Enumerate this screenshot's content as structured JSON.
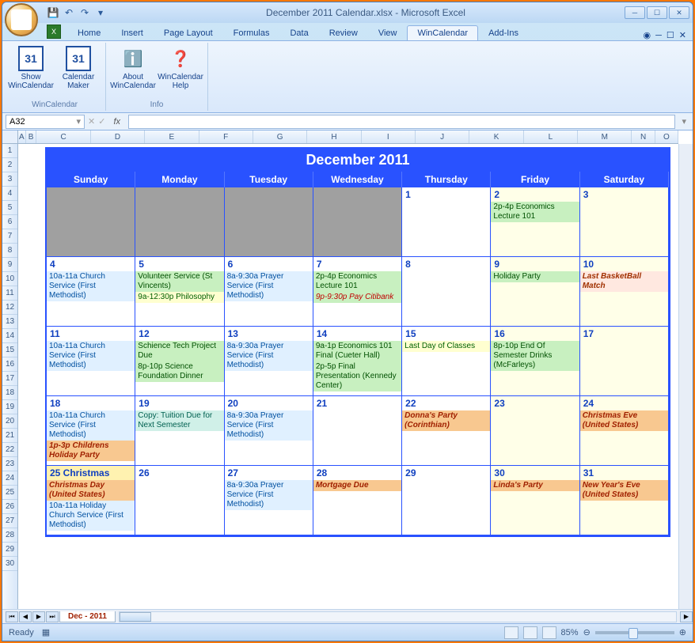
{
  "window": {
    "title": "December 2011 Calendar.xlsx - Microsoft Excel"
  },
  "tabs": {
    "items": [
      "Home",
      "Insert",
      "Page Layout",
      "Formulas",
      "Data",
      "Review",
      "View",
      "WinCalendar",
      "Add-Ins"
    ],
    "active": "WinCalendar"
  },
  "ribbon": {
    "groups": [
      {
        "label": "WinCalendar",
        "buttons": [
          {
            "icon": "📅",
            "iconText": "31",
            "label": "Show WinCalendar"
          },
          {
            "icon": "📅",
            "iconText": "31",
            "label": "Calendar Maker"
          }
        ]
      },
      {
        "label": "Info",
        "buttons": [
          {
            "icon": "ℹ️",
            "label": "About WinCalendar"
          },
          {
            "icon": "❓",
            "label": "WinCalendar Help"
          }
        ]
      }
    ]
  },
  "formulaBar": {
    "nameBox": "A32",
    "fx": "fx"
  },
  "columns": [
    "A",
    "B",
    "C",
    "D",
    "E",
    "F",
    "G",
    "H",
    "I",
    "J",
    "K",
    "L",
    "M",
    "N",
    "O"
  ],
  "rows": [
    "1",
    "2",
    "3",
    "4",
    "5",
    "6",
    "7",
    "8",
    "9",
    "10",
    "11",
    "12",
    "13",
    "14",
    "15",
    "16",
    "17",
    "18",
    "19",
    "20",
    "21",
    "22",
    "23",
    "24",
    "25",
    "26",
    "27",
    "28",
    "29",
    "30"
  ],
  "calendar": {
    "title": "December 2011",
    "days": [
      "Sunday",
      "Monday",
      "Tuesday",
      "Wednesday",
      "Thursday",
      "Friday",
      "Saturday"
    ],
    "cells": [
      {
        "date": "",
        "prev": true
      },
      {
        "date": "",
        "prev": true
      },
      {
        "date": "",
        "prev": true
      },
      {
        "date": "",
        "prev": true
      },
      {
        "date": "1",
        "events": []
      },
      {
        "date": "2",
        "alt": true,
        "events": [
          {
            "text": "2p-4p Economics Lecture 101",
            "cls": "green"
          }
        ]
      },
      {
        "date": "3",
        "alt": true,
        "events": []
      },
      {
        "date": "4",
        "events": [
          {
            "text": "10a-11a Church Service (First Methodist)",
            "cls": "lightblue"
          }
        ]
      },
      {
        "date": "5",
        "events": [
          {
            "text": "Volunteer Service (St Vincents)",
            "cls": "green"
          },
          {
            "text": "9a-12:30p Philosophy",
            "cls": "yellow"
          }
        ]
      },
      {
        "date": "6",
        "events": [
          {
            "text": "8a-9:30a Prayer Service (First Methodist)",
            "cls": "lightblue"
          }
        ]
      },
      {
        "date": "7",
        "events": [
          {
            "text": "2p-4p Economics Lecture 101",
            "cls": "green"
          },
          {
            "text": "9p-9:30p Pay Citibank",
            "cls": "red-on-green"
          }
        ]
      },
      {
        "date": "8",
        "events": []
      },
      {
        "date": "9",
        "alt": true,
        "events": [
          {
            "text": "Holiday Party",
            "cls": "green"
          }
        ]
      },
      {
        "date": "10",
        "alt": true,
        "events": [
          {
            "text": "Last BasketBall Match",
            "cls": "pink"
          }
        ]
      },
      {
        "date": "11",
        "events": [
          {
            "text": "10a-11a Church Service (First Methodist)",
            "cls": "lightblue"
          }
        ]
      },
      {
        "date": "12",
        "events": [
          {
            "text": "Schience Tech Project Due",
            "cls": "green"
          },
          {
            "text": "8p-10p Science Foundation Dinner",
            "cls": "green"
          }
        ]
      },
      {
        "date": "13",
        "events": [
          {
            "text": "8a-9:30a Prayer Service (First Methodist)",
            "cls": "lightblue"
          }
        ]
      },
      {
        "date": "14",
        "events": [
          {
            "text": "9a-1p Economics 101 Final (Cueter Hall)",
            "cls": "green"
          },
          {
            "text": "2p-5p Final Presentation (Kennedy Center)",
            "cls": "green"
          }
        ]
      },
      {
        "date": "15",
        "events": [
          {
            "text": "Last Day of Classes",
            "cls": "yellow"
          }
        ]
      },
      {
        "date": "16",
        "alt": true,
        "events": [
          {
            "text": "8p-10p End Of Semester Drinks (McFarleys)",
            "cls": "green"
          }
        ]
      },
      {
        "date": "17",
        "alt": true,
        "events": []
      },
      {
        "date": "18",
        "events": [
          {
            "text": "10a-11a Church Service (First Methodist)",
            "cls": "lightblue"
          },
          {
            "text": "1p-3p Childrens Holiday Party",
            "cls": "orange"
          }
        ]
      },
      {
        "date": "19",
        "events": [
          {
            "text": "Copy: Tuition Due for Next Semester",
            "cls": "teal"
          }
        ]
      },
      {
        "date": "20",
        "events": [
          {
            "text": "8a-9:30a Prayer Service (First Methodist)",
            "cls": "lightblue"
          }
        ]
      },
      {
        "date": "21",
        "events": []
      },
      {
        "date": "22",
        "events": [
          {
            "text": "Donna's Party (Corinthian)",
            "cls": "orange"
          }
        ]
      },
      {
        "date": "23",
        "alt": true,
        "events": []
      },
      {
        "date": "24",
        "alt": true,
        "events": [
          {
            "text": "Christmas Eve (United States)",
            "cls": "orange"
          }
        ]
      },
      {
        "date": "25",
        "holiday": "Christmas",
        "events": [
          {
            "text": "Christmas Day (United States)",
            "cls": "orange"
          },
          {
            "text": "10a-11a Holiday Church Service (First Methodist)",
            "cls": "lightblue"
          }
        ]
      },
      {
        "date": "26",
        "events": []
      },
      {
        "date": "27",
        "events": [
          {
            "text": "8a-9:30a Prayer Service (First Methodist)",
            "cls": "lightblue"
          }
        ]
      },
      {
        "date": "28",
        "events": [
          {
            "text": "Mortgage Due",
            "cls": "orange"
          }
        ]
      },
      {
        "date": "29",
        "events": []
      },
      {
        "date": "30",
        "alt": true,
        "events": [
          {
            "text": "Linda's Party",
            "cls": "orange"
          }
        ]
      },
      {
        "date": "31",
        "alt": true,
        "events": [
          {
            "text": "New Year's Eve (United States)",
            "cls": "orange"
          }
        ]
      }
    ]
  },
  "sheetTab": "Dec - 2011",
  "status": {
    "ready": "Ready",
    "zoom": "85%"
  }
}
